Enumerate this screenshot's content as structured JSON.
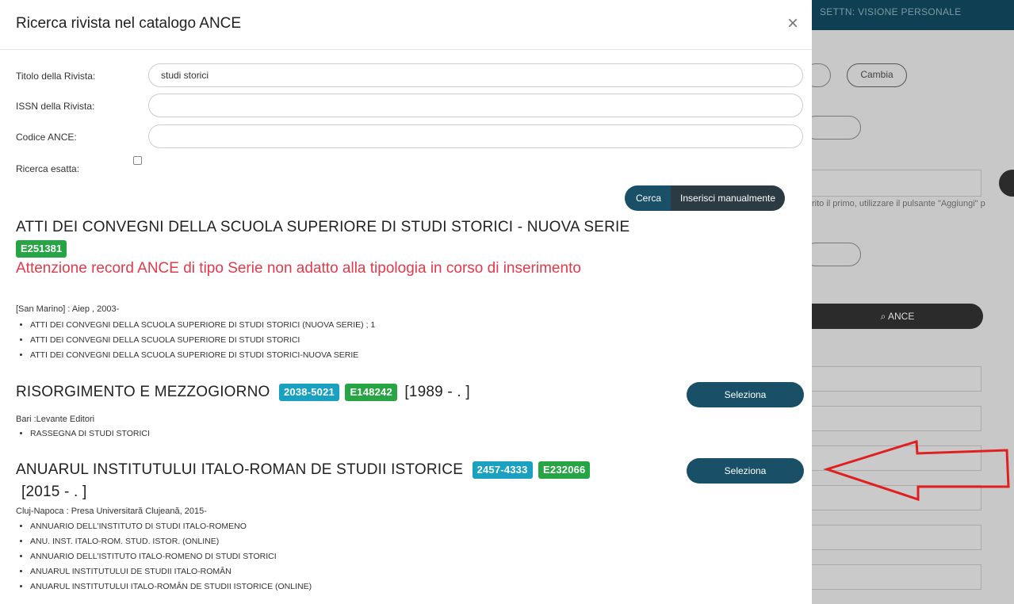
{
  "background": {
    "topbar_text": "SETTN: VISIONE PERSONALE",
    "cambia_label": "Cambia",
    "note": "rito il primo, utilizzare il pulsante \"Aggiungi\" p",
    "search_button": "⌕ ANCE"
  },
  "modal": {
    "title": "Ricerca rivista nel catalogo ANCE",
    "close": "×",
    "form": {
      "title_label": "Titolo della Rivista:",
      "title_value": "studi storici",
      "issn_label": "ISSN della Rivista:",
      "issn_value": "",
      "code_label": "Codice ANCE:",
      "code_value": "",
      "exact_label": "Ricerca esatta:"
    },
    "buttons": {
      "search": "Cerca",
      "manual": "Inserisci manualmente"
    }
  },
  "results": [
    {
      "title": "ATTI DEI CONVEGNI DELLA SCUOLA SUPERIORE DI STUDI STORICI - NUOVA SERIE",
      "ance_code": "E251381",
      "warning": "Attenzione record ANCE di tipo Serie non adatto alla tipologia in corso di inserimento",
      "publisher": "[San Marino] : Aiep , 2003-",
      "alt_titles": [
        "ATTI DEI CONVEGNI DELLA SCUOLA SUPERIORE DI STUDI STORICI (NUOVA SERIE) ; 1",
        "ATTI DEI CONVEGNI DELLA SCUOLA SUPERIORE DI STUDI STORICI",
        "ATTI DEI CONVEGNI DELLA SCUOLA SUPERIORE DI STUDI STORICI-NUOVA SERIE"
      ]
    },
    {
      "title": "RISORGIMENTO E MEZZOGIORNO",
      "issn": "2038-5021",
      "ance_code": "E148242",
      "years": "[1989 - . ]",
      "select": "Seleziona",
      "publisher": "Bari :Levante Editori",
      "alt_titles": [
        "RASSEGNA DI STUDI STORICI"
      ]
    },
    {
      "title": "ANUARUL INSTITUTULUI ITALO-ROMAN DE STUDII ISTORICE",
      "issn": "2457-4333",
      "ance_code": "E232066",
      "years": "[2015 - . ]",
      "select": "Seleziona",
      "publisher": "Cluj-Napoca : Presa Universitară Clujeană, 2015-",
      "alt_titles": [
        "ANNUARIO DELL'INSTITUTO DI STUDI ITALO-ROMENO",
        "ANU. INST. ITALO-ROM. STUD. ISTOR. (ONLINE)",
        "ANNUARIO DELL'ISTITUTO ITALO-ROMENO DI STUDI STORICI",
        "ANUARUL INSTITUTULUI DE STUDII ITALO-ROMÂN",
        "ANUARUL INSTITUTULUI ITALO-ROMÂN DE STUDII ISTORICE (ONLINE)"
      ]
    }
  ],
  "colors": {
    "primary": "#1a4f68",
    "green_badge": "#27a444",
    "cyan_badge": "#1aa0c0",
    "warning": "#e23a4a",
    "annotation_arrow": "#e02020"
  }
}
